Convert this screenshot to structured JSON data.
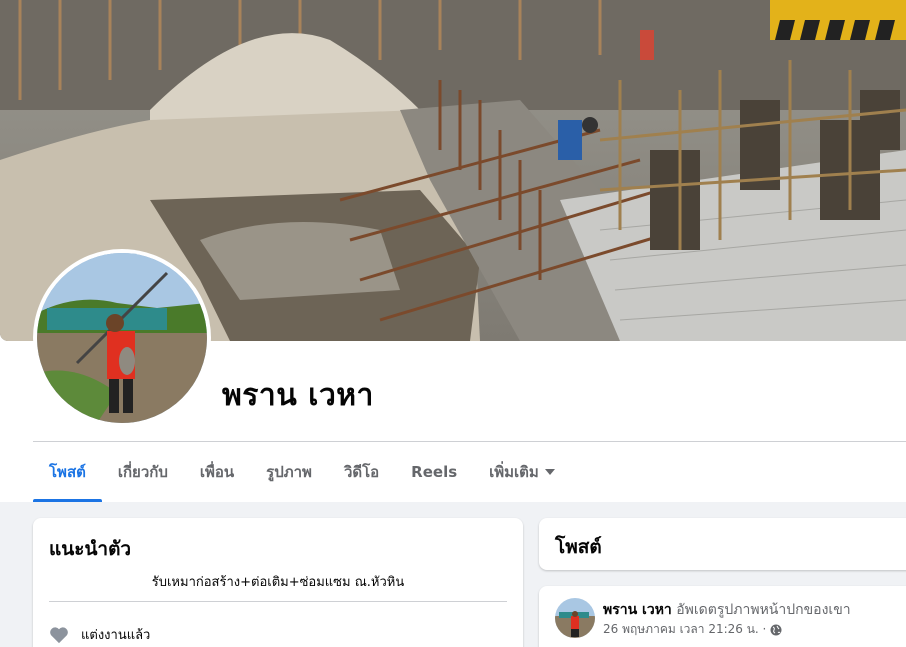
{
  "profile": {
    "name": "พราน เวหา"
  },
  "tabs": [
    {
      "label": "โพสต์",
      "active": true
    },
    {
      "label": "เกี่ยวกับ"
    },
    {
      "label": "เพื่อน"
    },
    {
      "label": "รูปภาพ"
    },
    {
      "label": "วิดีโอ"
    },
    {
      "label": "Reels"
    },
    {
      "label": "เพิ่มเติม"
    }
  ],
  "intro": {
    "title": "แนะนำตัว",
    "bio": "รับเหมาก่อสร้าง+ต่อเติม+ซ่อมแซม ณ.หัวหิน",
    "relationship": "แต่งงานแล้ว"
  },
  "posts": {
    "title": "โพสต์",
    "first": {
      "author": "พราน เวหา",
      "action": "อัพเดตรูปภาพหน้าปกของเขา",
      "timestamp": "26 พฤษภาคม เวลา 21:26 น. ·"
    }
  },
  "colors": {
    "accent": "#1b74e4",
    "background": "#f0f2f5",
    "muted_text": "#65676b"
  },
  "icons": {
    "relationship": "heart-icon",
    "privacy": "globe-icon",
    "more": "caret-down-icon"
  }
}
